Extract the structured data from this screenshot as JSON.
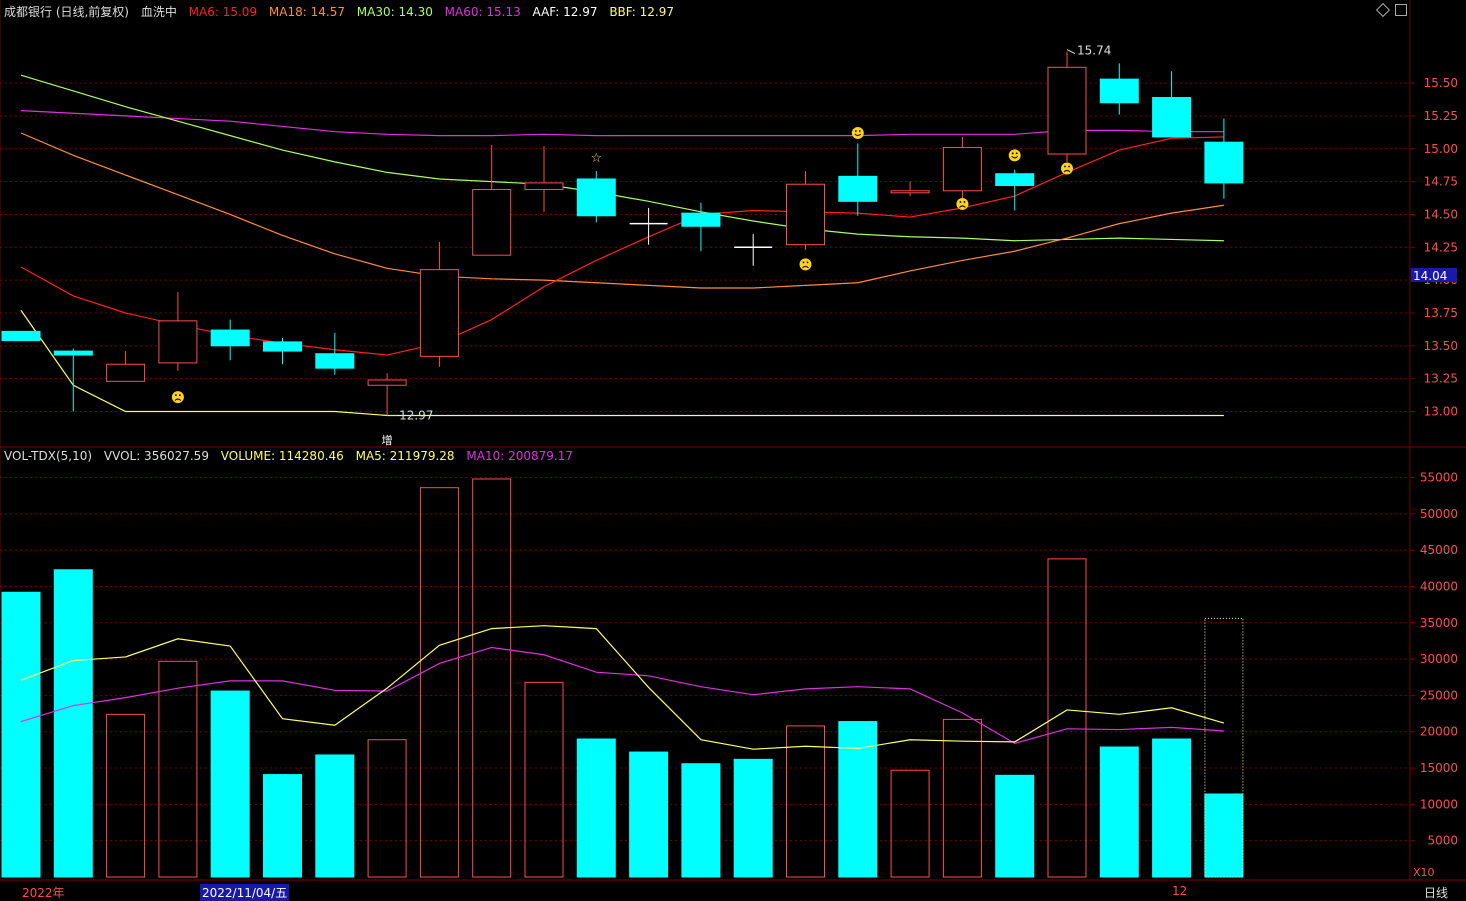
{
  "header": {
    "title": "成都银行 (日线,前复权)",
    "indicator": "血洗中",
    "ma6": "MA6: 15.09",
    "ma18": "MA18: 14.57",
    "ma30": "MA30: 14.30",
    "ma60": "MA60: 15.13",
    "aaf": "AAF: 12.97",
    "bbf": "BBF: 12.97"
  },
  "volume_header": {
    "title": "VOL-TDX(5,10)",
    "vvol": "VVOL: 356027.59",
    "volume": "VOLUME: 114280.46",
    "ma5": "MA5: 211979.28",
    "ma10": "MA10: 200879.17"
  },
  "footer": {
    "year": "2022年",
    "date": "2022/11/04/五",
    "month": "12",
    "period": "日线",
    "multiplier": "X10"
  },
  "colors": {
    "up": "#ff4d4d",
    "down": "#00ffff",
    "ma6": "#ff2020",
    "ma18": "#ff8c3a",
    "ma30": "#a8ff60",
    "ma60": "#e030e0",
    "aaf": "#ffff66",
    "grid": "#7a0000"
  },
  "chart_data": [
    {
      "type": "candlestick",
      "y_ticks": [
        13.0,
        13.25,
        13.5,
        13.75,
        14.0,
        14.25,
        14.5,
        14.75,
        15.0,
        15.25,
        15.5
      ],
      "ylim": [
        12.73,
        15.98
      ],
      "current_price_label": "14.04",
      "high_label": "15.74",
      "low_label": "12.97",
      "candles": [
        {
          "o": 13.61,
          "c": 13.54,
          "h": 13.61,
          "l": 13.54
        },
        {
          "o": 13.46,
          "c": 13.43,
          "h": 13.48,
          "l": 13.0
        },
        {
          "o": 13.23,
          "c": 13.36,
          "h": 13.46,
          "l": 13.23
        },
        {
          "o": 13.37,
          "c": 13.69,
          "h": 13.91,
          "l": 13.31
        },
        {
          "o": 13.62,
          "c": 13.5,
          "h": 13.7,
          "l": 13.39
        },
        {
          "o": 13.53,
          "c": 13.46,
          "h": 13.56,
          "l": 13.36
        },
        {
          "o": 13.44,
          "c": 13.33,
          "h": 13.6,
          "l": 13.28
        },
        {
          "o": 13.2,
          "c": 13.24,
          "h": 13.29,
          "l": 12.97
        },
        {
          "o": 13.42,
          "c": 14.08,
          "h": 14.29,
          "l": 13.34
        },
        {
          "o": 14.19,
          "c": 14.69,
          "h": 15.03,
          "l": 14.19
        },
        {
          "o": 14.69,
          "c": 14.74,
          "h": 15.02,
          "l": 14.52
        },
        {
          "o": 14.77,
          "c": 14.49,
          "h": 14.83,
          "l": 14.44
        },
        {
          "o": 14.43,
          "c": 14.43,
          "h": 14.55,
          "l": 14.27
        },
        {
          "o": 14.51,
          "c": 14.41,
          "h": 14.59,
          "l": 14.22
        },
        {
          "o": 14.25,
          "c": 14.25,
          "h": 14.35,
          "l": 14.11
        },
        {
          "o": 14.27,
          "c": 14.73,
          "h": 14.83,
          "l": 14.23
        },
        {
          "o": 14.79,
          "c": 14.6,
          "h": 15.04,
          "l": 14.49
        },
        {
          "o": 14.67,
          "c": 14.68,
          "h": 14.75,
          "l": 14.64
        },
        {
          "o": 14.68,
          "c": 15.01,
          "h": 15.09,
          "l": 14.62
        },
        {
          "o": 14.81,
          "c": 14.72,
          "h": 14.84,
          "l": 14.53
        },
        {
          "o": 14.96,
          "c": 15.62,
          "h": 15.74,
          "l": 14.9
        },
        {
          "o": 15.53,
          "c": 15.35,
          "h": 15.65,
          "l": 15.26
        },
        {
          "o": 15.39,
          "c": 15.09,
          "h": 15.59,
          "l": 15.09
        },
        {
          "o": 15.05,
          "c": 14.74,
          "h": 15.23,
          "l": 14.62
        }
      ],
      "ma6": [
        14.1,
        13.88,
        13.75,
        13.66,
        13.58,
        13.52,
        13.47,
        13.43,
        13.52,
        13.7,
        13.95,
        14.15,
        14.33,
        14.5,
        14.53,
        14.52,
        14.51,
        14.48,
        14.55,
        14.64,
        14.82,
        14.99,
        15.08,
        15.09
      ],
      "ma18": [
        15.12,
        14.95,
        14.8,
        14.65,
        14.5,
        14.34,
        14.2,
        14.09,
        14.03,
        14.01,
        14.0,
        13.98,
        13.96,
        13.94,
        13.94,
        13.96,
        13.98,
        14.07,
        14.15,
        14.22,
        14.32,
        14.43,
        14.51,
        14.57
      ],
      "ma30": [
        15.56,
        15.44,
        15.32,
        15.21,
        15.1,
        14.99,
        14.9,
        14.82,
        14.77,
        14.75,
        14.73,
        14.67,
        14.6,
        14.52,
        14.45,
        14.39,
        14.35,
        14.33,
        14.32,
        14.3,
        14.31,
        14.32,
        14.31,
        14.3
      ],
      "ma60": [
        15.29,
        15.27,
        15.25,
        15.23,
        15.21,
        15.17,
        15.13,
        15.11,
        15.1,
        15.1,
        15.11,
        15.1,
        15.1,
        15.1,
        15.1,
        15.1,
        15.1,
        15.11,
        15.11,
        15.11,
        15.14,
        15.14,
        15.13,
        15.13
      ],
      "aaf": [
        13.77,
        13.2,
        13.0,
        13.0,
        13.0,
        13.0,
        13.0,
        12.97,
        12.97,
        12.97,
        12.97,
        12.97,
        12.97,
        12.97,
        12.97,
        12.97,
        12.97,
        12.97,
        12.97,
        12.97,
        12.97,
        12.97,
        12.97,
        12.97
      ],
      "markers": [
        {
          "i": 3,
          "kind": "sad",
          "price": 13.11
        },
        {
          "i": 11,
          "kind": "star",
          "price": 14.93
        },
        {
          "i": 15,
          "kind": "sad",
          "price": 14.12
        },
        {
          "i": 16,
          "kind": "happy",
          "price": 15.12
        },
        {
          "i": 18,
          "kind": "sad",
          "price": 14.58
        },
        {
          "i": 19,
          "kind": "happy",
          "price": 14.95
        },
        {
          "i": 20,
          "kind": "sad",
          "price": 14.85
        },
        {
          "i": 7,
          "kind": "text",
          "text": "增",
          "price": 12.73
        }
      ]
    },
    {
      "type": "volume_bar",
      "y_ticks": [
        5000,
        10000,
        15000,
        20000,
        25000,
        30000,
        35000,
        40000,
        45000,
        50000,
        55000
      ],
      "ylim": [
        0,
        57000
      ],
      "volumes": [
        39200,
        42300,
        22400,
        29700,
        25600,
        14100,
        16800,
        18900,
        53600,
        54800,
        26800,
        19000,
        17200,
        15600,
        16200,
        20800,
        21400,
        14700,
        21700,
        14000,
        43800,
        17900,
        19000,
        11428
      ],
      "bar_up": [
        false,
        false,
        true,
        true,
        false,
        false,
        false,
        true,
        true,
        true,
        true,
        false,
        false,
        false,
        false,
        true,
        false,
        true,
        true,
        false,
        true,
        false,
        false,
        false
      ],
      "projected_volume": 35600,
      "ma5": [
        27100,
        29800,
        30300,
        32800,
        31800,
        21800,
        20900,
        26000,
        31900,
        34200,
        34600,
        34200,
        26100,
        18900,
        17600,
        18000,
        17700,
        18900,
        18700,
        18600,
        23000,
        22400,
        23300,
        21200
      ],
      "ma10": [
        21400,
        23600,
        24700,
        26000,
        27000,
        27000,
        25700,
        25600,
        29400,
        31600,
        30600,
        28200,
        27700,
        26200,
        25100,
        25900,
        26200,
        25900,
        22600,
        18400,
        20400,
        20300,
        20600,
        20100
      ]
    }
  ]
}
